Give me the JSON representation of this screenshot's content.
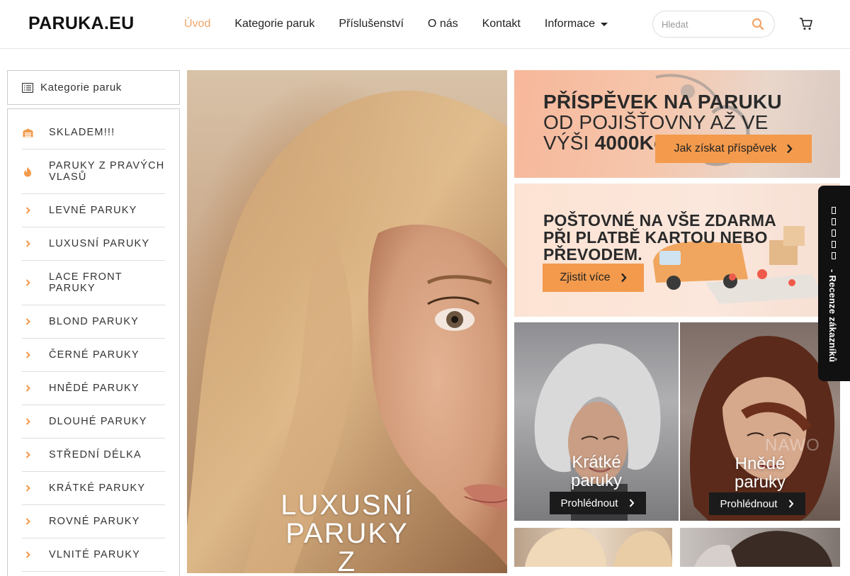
{
  "header": {
    "logo": "PARUKA.EU",
    "nav": [
      {
        "label": "Úvod",
        "active": true
      },
      {
        "label": "Kategorie paruk"
      },
      {
        "label": "Příslušenství"
      },
      {
        "label": "O nás"
      },
      {
        "label": "Kontakt"
      },
      {
        "label": "Informace",
        "has_dropdown": true
      }
    ],
    "search": {
      "placeholder": "Hledat",
      "icon": "search-icon"
    },
    "cart_icon": "cart-icon"
  },
  "sidebar": {
    "title": "Kategorie paruk",
    "items": [
      {
        "label": "SKLADEM!!!",
        "icon": "warehouse-icon"
      },
      {
        "label": "PARUKY Z PRAVÝCH VLASŮ",
        "icon": "fire-icon"
      },
      {
        "label": "LEVNÉ PARUKY",
        "icon": "chevron-right-icon"
      },
      {
        "label": "LUXUSNÍ PARUKY",
        "icon": "chevron-right-icon"
      },
      {
        "label": "LACE FRONT PARUKY",
        "icon": "chevron-right-icon"
      },
      {
        "label": "BLOND PARUKY",
        "icon": "chevron-right-icon"
      },
      {
        "label": "ČERNÉ PARUKY",
        "icon": "chevron-right-icon"
      },
      {
        "label": "HNĚDÉ PARUKY",
        "icon": "chevron-right-icon"
      },
      {
        "label": "DLOUHÉ PARUKY",
        "icon": "chevron-right-icon"
      },
      {
        "label": "STŘEDNÍ DÉLKA",
        "icon": "chevron-right-icon"
      },
      {
        "label": "KRÁTKÉ PARUKY",
        "icon": "chevron-right-icon"
      },
      {
        "label": "ROVNÉ PARUKY",
        "icon": "chevron-right-icon"
      },
      {
        "label": "VLNITÉ PARUKY",
        "icon": "chevron-right-icon"
      }
    ]
  },
  "hero": {
    "title_lines": [
      "LUXUSNÍ",
      "PARUKY",
      "Z"
    ]
  },
  "banner_insurance": {
    "line1": "PŘÍSPĚVEK NA PARUKU",
    "line2": "OD POJIŠŤOVNY AŽ VE",
    "line3_prefix": "VÝŠI",
    "line3_amount": "4000Kč",
    "button": "Jak získat příspěvek"
  },
  "banner_shipping": {
    "line1": "POŠTOVNÉ NA VŠE ZDARMA",
    "line2": "PŘI PLATBĚ KARTOU NEBO",
    "line3": "PŘEVODEM.",
    "button": "Zjistit více"
  },
  "tiles": [
    {
      "title_line1": "Krátké",
      "title_line2": "paruky",
      "button": "Prohlédnout"
    },
    {
      "title_line1": "Hnědé",
      "title_line2": "paruky",
      "button": "Prohlédnout",
      "watermark": "NAWO"
    }
  ],
  "review_tab": {
    "label": "- Recenze zákazníků"
  },
  "colors": {
    "accent": "#f0a56a",
    "button_orange": "#f39a4c",
    "dark_button": "#1b1b1b"
  }
}
